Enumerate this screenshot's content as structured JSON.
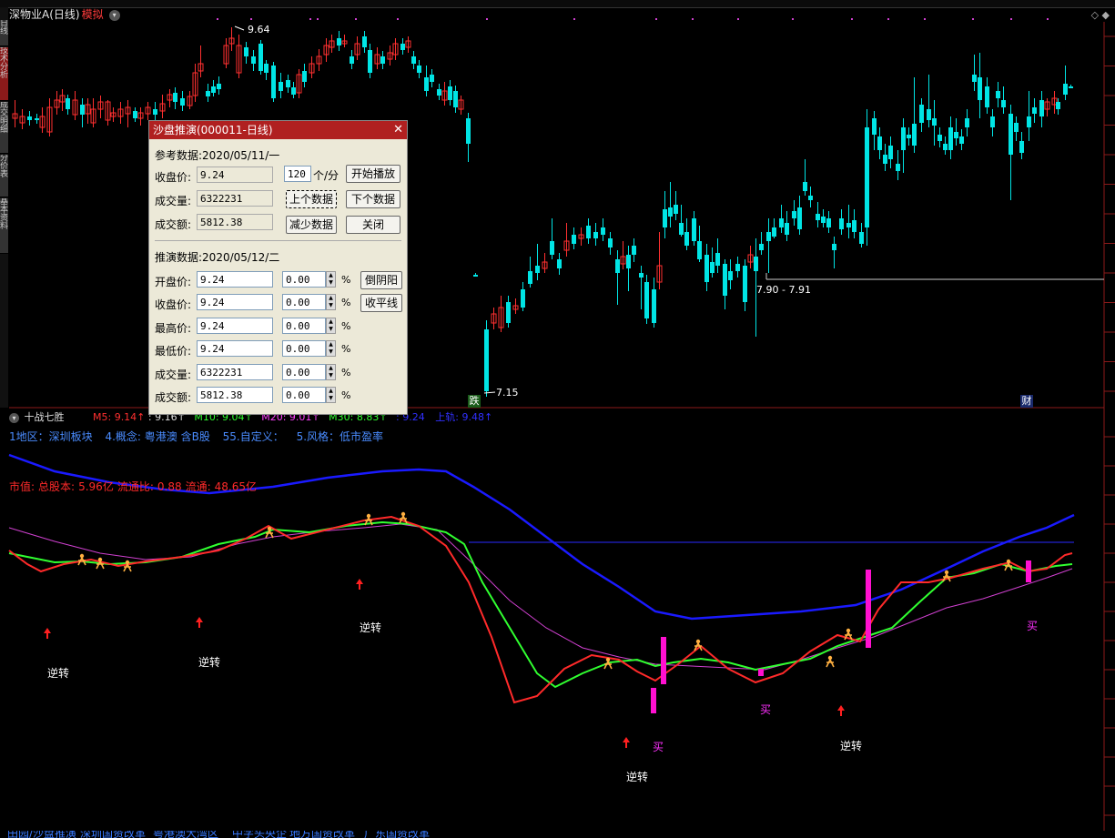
{
  "window": {
    "stock_title": "深物业A(日线)",
    "mode": "模拟",
    "top_right": "◇ ◆"
  },
  "side_tabs": [
    "日线",
    "技术分析",
    "成交明细",
    "分价表",
    "基本资料"
  ],
  "price_labels": {
    "high": "9.64",
    "low": "7.15",
    "range": "7.90 - 7.91"
  },
  "markers": {
    "die": "跌",
    "cai": "财"
  },
  "dialog": {
    "title": "沙盘推演(000011-日线)",
    "close": "✕",
    "ref_label": "参考数据:2020/05/11/一",
    "close_price_label": "收盘价:",
    "close_price_value": "9.24",
    "volume_label": "成交量:",
    "volume_value": "6322231",
    "amount_label": "成交额:",
    "amount_value": "5812.38",
    "speed_value": "120",
    "speed_unit": "个/分",
    "btn_play": "开始播放",
    "btn_prev": "上个数据",
    "btn_next": "下个数据",
    "btn_reduce": "减少数据",
    "btn_close": "关闭",
    "sim_label": "推演数据:2020/05/12/二",
    "sim_rows": [
      {
        "label": "开盘价:",
        "value": "9.24",
        "pct": "0.00"
      },
      {
        "label": "收盘价:",
        "value": "9.24",
        "pct": "0.00"
      },
      {
        "label": "最高价:",
        "value": "9.24",
        "pct": "0.00"
      },
      {
        "label": "最低价:",
        "value": "9.24",
        "pct": "0.00"
      },
      {
        "label": "成交量:",
        "value": "6322231",
        "pct": "0.00"
      },
      {
        "label": "成交额:",
        "value": "5812.38",
        "pct": "0.00"
      }
    ],
    "pct_sign": "%",
    "btn_invert": "倒阴阳",
    "btn_flat": "收平线"
  },
  "indicator": {
    "name": "十战七胜",
    "m5": "M5: 9.14↑",
    "m5b": ": 9.16↑",
    "m10": "M10: 9.04↑",
    "m20": "M20: 9.01↑",
    "m30": "M30: 8.83↑",
    "v924": ": 9.24",
    "upper": "上轨: 9.48↑",
    "colors": {
      "m5": "#ff3030",
      "m10": "#30ff30",
      "m20": "#ff40ff",
      "m30": "#30ff30",
      "upper": "#3030ff"
    }
  },
  "info_line": [
    "1地区：深圳板块",
    "4.概念: 粤港澳 含B股",
    "55.自定义：",
    "5.风格：低市盈率"
  ],
  "cap_line": [
    "市值:",
    "总股本:",
    "5.96亿",
    "流通比:",
    "0.88",
    "流通:",
    "48.65亿"
  ],
  "annotations": {
    "reverse": "逆转",
    "buy": "买"
  },
  "bottom_tabs": [
    "田园/沙盘推演",
    "深圳国资改革",
    "粤港澳大湾区",
    "中字头央企",
    "地方国资改革",
    "广东国资改革"
  ]
}
